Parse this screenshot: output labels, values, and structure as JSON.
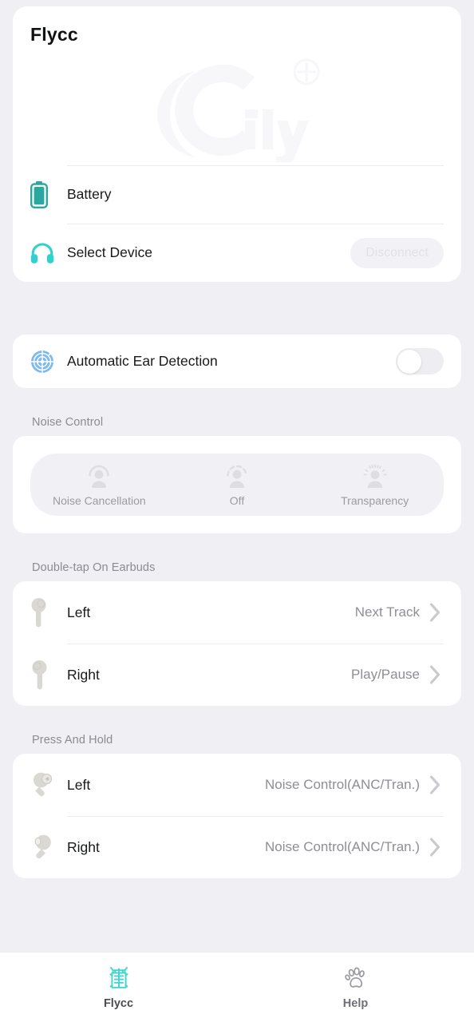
{
  "colors": {
    "background": "#f0eff4",
    "card": "#ffffff",
    "accent_teal": "#2ecfc8",
    "battery_teal": "#2aa79f",
    "radar_blue": "#5aa7e8",
    "muted_text": "#8e8e94",
    "section_header": "#8b8b92",
    "primary_text": "#18191b",
    "disabled_button_bg": "#f2f1f5",
    "disabled_button_text": "#e2e1e7"
  },
  "header": {
    "app_title": "Flycc",
    "watermark_text": "fly",
    "watermark_icon": "cc-fly-logo-watermark"
  },
  "device": {
    "battery": {
      "icon": "battery-icon",
      "label": "Battery"
    },
    "select_device": {
      "icon": "headphones-icon",
      "label": "Select Device",
      "button_label": "Disconnect",
      "button_enabled": false
    }
  },
  "ear_detection": {
    "icon": "radar-target-icon",
    "label": "Automatic Ear Detection",
    "toggle_state": "off"
  },
  "noise_control": {
    "section_title": "Noise Control",
    "selected": null,
    "options": [
      {
        "label": "Noise Cancellation",
        "icon": "person-noise-cancellation-icon"
      },
      {
        "label": "Off",
        "icon": "person-off-icon"
      },
      {
        "label": "Transparency",
        "icon": "person-transparency-icon"
      }
    ]
  },
  "double_tap": {
    "section_title": "Double-tap On Earbuds",
    "rows": [
      {
        "icon": "earbud-left-icon",
        "label": "Left",
        "value": "Next Track",
        "chevron": "chevron-right-icon"
      },
      {
        "icon": "earbud-right-icon",
        "label": "Right",
        "value": "Play/Pause",
        "chevron": "chevron-right-icon"
      }
    ]
  },
  "press_and_hold": {
    "section_title": "Press And Hold",
    "rows": [
      {
        "icon": "earbud-press-left-icon",
        "label": "Left",
        "value": "Noise Control(ANC/Tran.)",
        "chevron": "chevron-right-icon"
      },
      {
        "icon": "earbud-press-right-icon",
        "label": "Right",
        "value": "Noise Control(ANC/Tran.)",
        "chevron": "chevron-right-icon"
      }
    ]
  },
  "tabbar": {
    "tabs": [
      {
        "label": "Flycc",
        "icon": "flycc-glyph-icon",
        "active": true
      },
      {
        "label": "Help",
        "icon": "paw-print-icon",
        "active": false
      }
    ]
  }
}
